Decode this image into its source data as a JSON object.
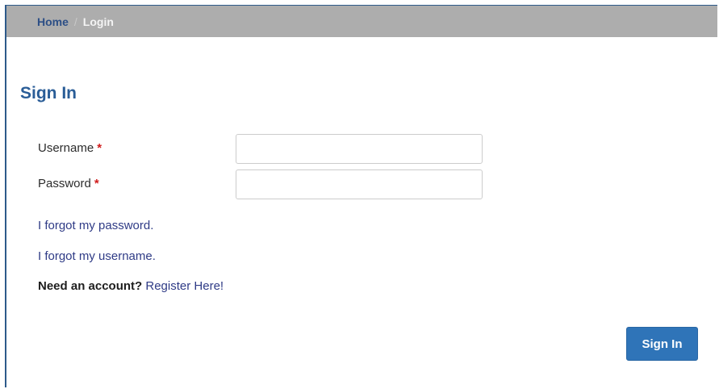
{
  "breadcrumb": {
    "home": "Home",
    "separator": "/",
    "current": "Login"
  },
  "page": {
    "title": "Sign In"
  },
  "form": {
    "username_label": "Username",
    "password_label": "Password",
    "required_marker": "*",
    "username_value": "",
    "password_value": ""
  },
  "links": {
    "forgot_password": "I forgot my password.",
    "forgot_username": "I forgot my username.",
    "need_account": "Need an account?",
    "register": "Register Here!"
  },
  "actions": {
    "signin_label": "Sign In"
  },
  "colors": {
    "accent": "#2a5d97",
    "button": "#2f74b8",
    "breadcrumb_bg": "#adadad",
    "required": "#d01b1b",
    "link": "#2f3b86"
  }
}
